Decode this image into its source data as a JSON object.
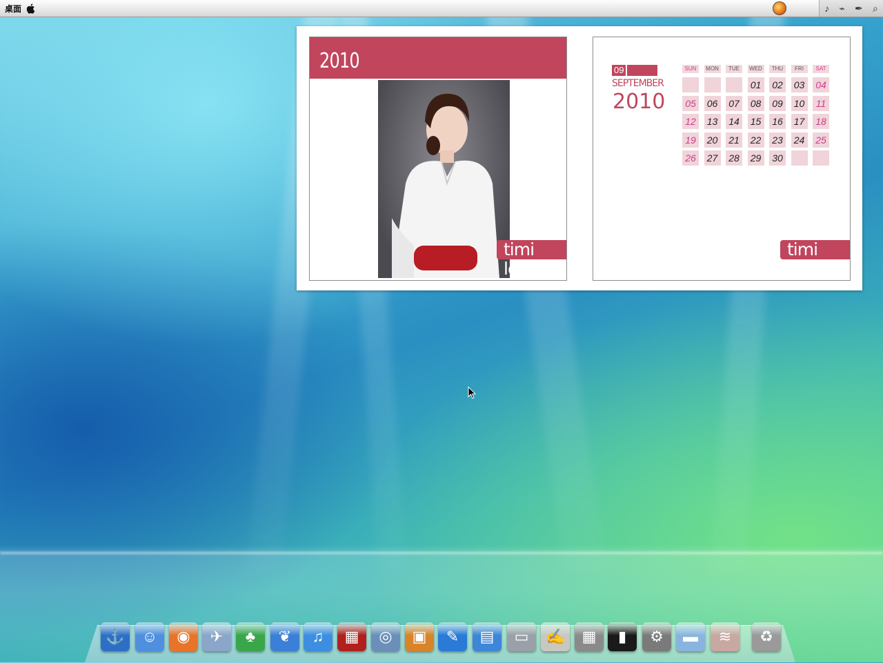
{
  "menubar": {
    "title": "桌面"
  },
  "widget": {
    "photo_panel": {
      "year": "2010",
      "tag": "timi love"
    },
    "calendar_panel": {
      "month_number": "09",
      "month_name": "SEPTEMBER",
      "year": "2010",
      "tag": "timi love",
      "weekdays": [
        "SUN",
        "MON",
        "TUE",
        "WED",
        "THU",
        "FRI",
        "SAT"
      ],
      "weeks": [
        [
          "",
          "",
          "",
          "01",
          "02",
          "03",
          "04"
        ],
        [
          "05",
          "06",
          "07",
          "08",
          "09",
          "10",
          "11"
        ],
        [
          "12",
          "13",
          "14",
          "15",
          "16",
          "17",
          "18"
        ],
        [
          "19",
          "20",
          "21",
          "22",
          "23",
          "24",
          "25"
        ],
        [
          "26",
          "27",
          "28",
          "29",
          "30",
          "",
          ""
        ]
      ]
    }
  },
  "colors": {
    "accent": "#c1455d",
    "weekend": "#d03a8a",
    "cell": "#f0d4da"
  },
  "dock": {
    "items": [
      {
        "name": "anchor-icon",
        "glyph": "⚓",
        "bg": "#2d6fc7"
      },
      {
        "name": "finder-icon",
        "glyph": "☺",
        "bg": "#4f8fe0"
      },
      {
        "name": "firefox-icon",
        "glyph": "◉",
        "bg": "#e8742a"
      },
      {
        "name": "mail-stamp-icon",
        "glyph": "✈",
        "bg": "#8aa6c8"
      },
      {
        "name": "qq-penguin-icon",
        "glyph": "♣",
        "bg": "#3aa64a"
      },
      {
        "name": "footprints-icon",
        "glyph": "❦",
        "bg": "#3a7fd8"
      },
      {
        "name": "itunes-icon",
        "glyph": "♫",
        "bg": "#3d8ee0"
      },
      {
        "name": "dvd-player-icon",
        "glyph": "▦",
        "bg": "#b0201c"
      },
      {
        "name": "iphoto-icon",
        "glyph": "◎",
        "bg": "#6a8fb8"
      },
      {
        "name": "photo-booth-icon",
        "glyph": "▣",
        "bg": "#d8842a"
      },
      {
        "name": "feather-icon",
        "glyph": "✎",
        "bg": "#2a7ad8"
      },
      {
        "name": "image-capture-icon",
        "glyph": "▤",
        "bg": "#3d86d8"
      },
      {
        "name": "scanner-icon",
        "glyph": "▭",
        "bg": "#9aa0a8"
      },
      {
        "name": "textedit-icon",
        "glyph": "✍",
        "bg": "#c8c8c0"
      },
      {
        "name": "calculator-icon",
        "glyph": "▦",
        "bg": "#8a8a8a"
      },
      {
        "name": "terminal-icon",
        "glyph": "▮",
        "bg": "#1a1a1a"
      },
      {
        "name": "system-preferences-icon",
        "glyph": "⚙",
        "bg": "#7a7a7a"
      },
      {
        "name": "folder-icon",
        "glyph": "▬",
        "bg": "#8ab4e0"
      },
      {
        "name": "stack-icon",
        "glyph": "≋",
        "bg": "#c8a8a0"
      },
      {
        "name": "trash-icon",
        "glyph": "♻",
        "bg": "#9a9a9a"
      }
    ]
  }
}
